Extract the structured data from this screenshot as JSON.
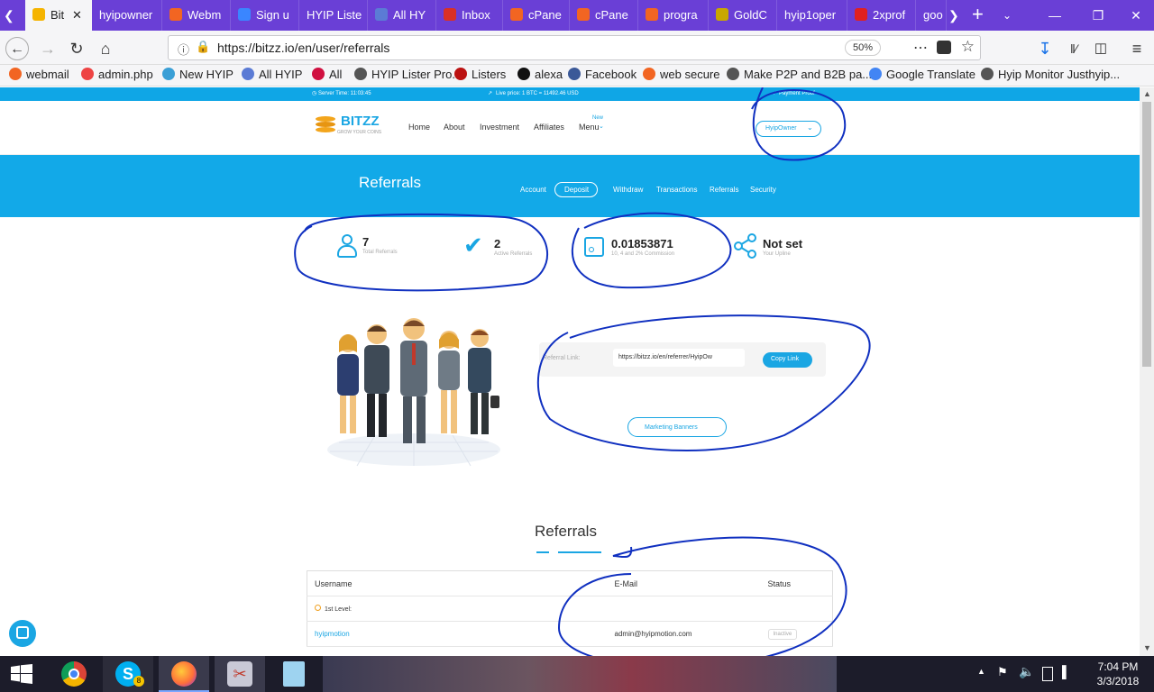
{
  "browser": {
    "tabs": [
      {
        "label": "Bit",
        "color": "#f5b400"
      },
      {
        "label": "hyipowner",
        "color": ""
      },
      {
        "label": "Webm",
        "color": "#f26522"
      },
      {
        "label": "Sign u",
        "color": "#3a86ff"
      },
      {
        "label": "HYIP Liste",
        "color": ""
      },
      {
        "label": "All HY",
        "color": "#5b7bd5"
      },
      {
        "label": "Inbox",
        "color": "#d93025"
      },
      {
        "label": "cPane",
        "color": "#f26522"
      },
      {
        "label": "cPane",
        "color": "#f26522"
      },
      {
        "label": "progra",
        "color": "#f26522"
      },
      {
        "label": "GoldC",
        "color": "#c9a700"
      },
      {
        "label": "hyip1oper",
        "color": ""
      },
      {
        "label": "2xprof",
        "color": "#e02020"
      },
      {
        "label": "goo",
        "color": ""
      }
    ],
    "url": "https://bitzz.io/en/user/referrals",
    "zoom": "50%",
    "bookmarks": [
      {
        "label": "webmail",
        "color": "#f26522"
      },
      {
        "label": "admin.php",
        "color": "#e44"
      },
      {
        "label": "New HYIP",
        "color": "#3a9fd6"
      },
      {
        "label": "All HYIP",
        "color": "#5b7bd5"
      },
      {
        "label": "All",
        "color": "#d01040"
      },
      {
        "label": "HYIP Lister Pro.",
        "color": "#555"
      },
      {
        "label": "Listers",
        "color": "#b11"
      },
      {
        "label": "alexa",
        "color": "#111"
      },
      {
        "label": "Facebook",
        "color": "#3b5998"
      },
      {
        "label": "web secure",
        "color": "#f26522"
      },
      {
        "label": "Make P2P and B2B pa...",
        "color": "#555"
      },
      {
        "label": "Google Translate",
        "color": "#4285f4"
      },
      {
        "label": "Hyip Monitor Justhyip...",
        "color": "#555"
      }
    ]
  },
  "site": {
    "server_time": "Server Time: 11:03:45",
    "live_price": "Live price: 1 BTC = 11492.46 USD",
    "payment_proof": "Payment Proof",
    "logo": "BITZZ",
    "tagline": "GROW YOUR COINS",
    "menu": [
      "Home",
      "About",
      "Investment",
      "Affiliates",
      "Menu"
    ],
    "menu_badge": "New",
    "user_button": "HyipOwner",
    "page_title": "Referrals",
    "sub_nav": [
      "Account",
      "Deposit",
      "Withdraw",
      "Transactions",
      "Referrals",
      "Security"
    ],
    "stats": [
      {
        "value": "7",
        "label": "Total Referrals"
      },
      {
        "value": "2",
        "label": "Active Referrals"
      },
      {
        "value": "0.01853871",
        "label": "10, 4 and 2% Commission"
      },
      {
        "value": "Not set",
        "label": "Your Upline"
      }
    ],
    "referral_link_label": "Referral Link:",
    "referral_link": "https://bitzz.io/en/referrer/HyipOw",
    "copy_link": "Copy Link",
    "marketing_banners": "Marketing Banners",
    "section_title": "Referrals",
    "table": {
      "headers": [
        "Username",
        "E-Mail",
        "Status"
      ],
      "level": "1st Level:",
      "rows": [
        {
          "username": "hyipmotion",
          "email": "admin@hyipmotion.com",
          "status": "Inactive"
        }
      ]
    }
  },
  "taskbar": {
    "time": "7:04 PM",
    "date": "3/3/2018",
    "skype_badge": "8"
  }
}
